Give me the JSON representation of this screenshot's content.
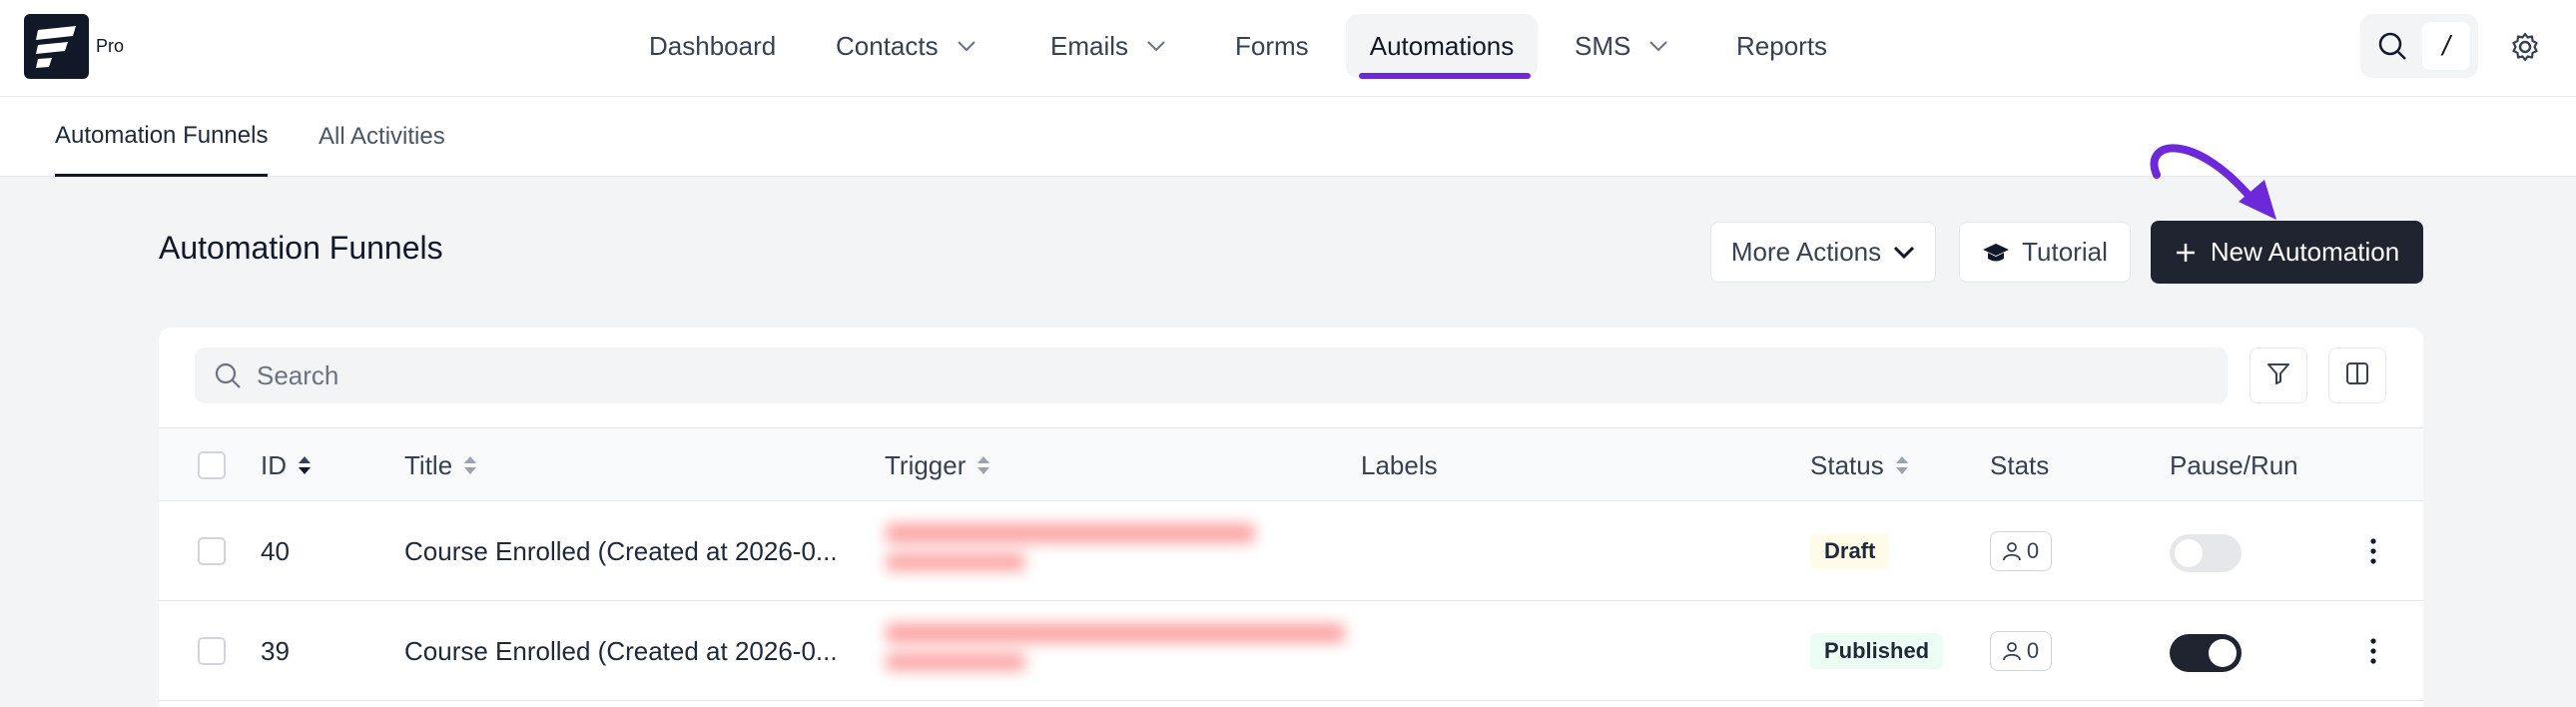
{
  "brand": {
    "badge": "Pro"
  },
  "nav": {
    "items": [
      {
        "label": "Dashboard"
      },
      {
        "label": "Contacts"
      },
      {
        "label": "Emails"
      },
      {
        "label": "Forms"
      },
      {
        "label": "Automations"
      },
      {
        "label": "SMS"
      },
      {
        "label": "Reports"
      }
    ],
    "search_shortcut": "/"
  },
  "subtabs": [
    {
      "label": "Automation Funnels"
    },
    {
      "label": "All Activities"
    }
  ],
  "page": {
    "title": "Automation Funnels",
    "more_actions": "More Actions",
    "tutorial": "Tutorial",
    "new_automation": "New Automation",
    "accent_color": "#6d28d9"
  },
  "table": {
    "search_placeholder": "Search",
    "columns": {
      "id": "ID",
      "title": "Title",
      "trigger": "Trigger",
      "labels": "Labels",
      "status": "Status",
      "stats": "Stats",
      "pause_run": "Pause/Run"
    },
    "rows": [
      {
        "id": "40",
        "title": "Course Enrolled (Created at 2026-0...",
        "status": "Draft",
        "stats": "0",
        "running": false
      },
      {
        "id": "39",
        "title": "Course Enrolled (Created at 2026-0...",
        "status": "Published",
        "stats": "0",
        "running": true
      }
    ]
  }
}
